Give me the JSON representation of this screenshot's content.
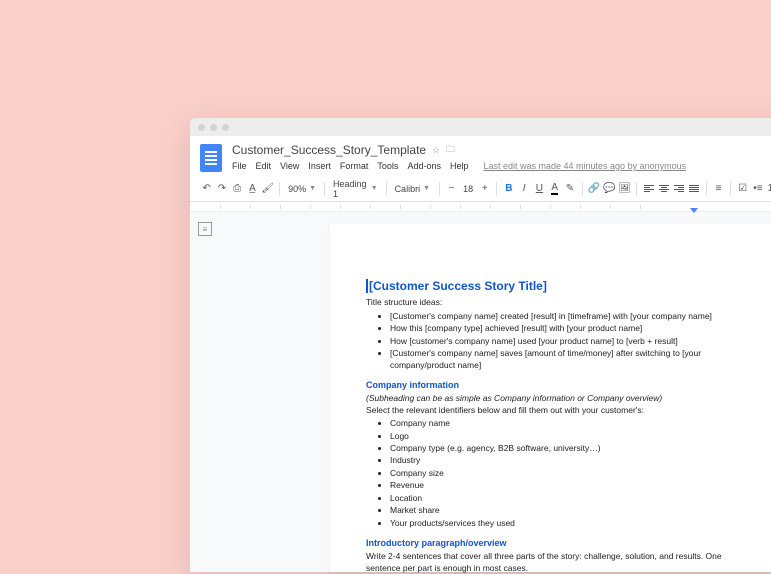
{
  "header": {
    "title": "Customer_Success_Story_Template",
    "last_edit": "Last edit was made 44 minutes ago by anonymous"
  },
  "menu": {
    "file": "File",
    "edit": "Edit",
    "view": "View",
    "insert": "Insert",
    "format": "Format",
    "tools": "Tools",
    "addons": "Add-ons",
    "help": "Help"
  },
  "toolbar": {
    "zoom": "90%",
    "style": "Heading 1",
    "font": "Calibri",
    "size": "18",
    "b": "B",
    "i": "I",
    "u": "U",
    "a": "A"
  },
  "doc": {
    "h1": "[Customer Success Story Title]",
    "title_ideas_label": "Title structure ideas:",
    "title_ideas": [
      "[Customer's company name] created [result] in [timeframe] with [your company name]",
      "How this [company type] achieved [result] with [your product name]",
      "How [customer's company name] used [your product name] to [verb + result]",
      "[Customer's company name] saves [amount of time/money] after switching to [your company/product name]"
    ],
    "company_h2": "Company information",
    "company_sub": "(Subheading can be as simple as Company information or Company overview)",
    "company_instr": "Select the relevant identifiers below and fill them out with your customer's:",
    "company_items": [
      "Company name",
      "Logo",
      "Company type (e.g. agency, B2B software, university…)",
      "Industry",
      "Company size",
      "Revenue",
      "Location",
      "Market share",
      "Your products/services they used"
    ],
    "intro_h2": "Introductory paragraph/overview",
    "intro_p1": "Write 2-4 sentences that cover all three parts of the story: challenge, solution, and results. One sentence per part is enough in most cases."
  }
}
